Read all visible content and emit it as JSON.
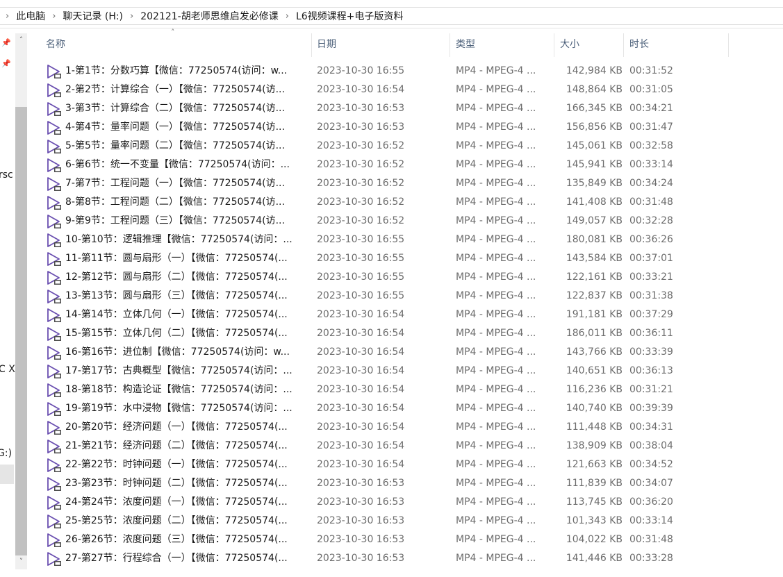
{
  "breadcrumb": {
    "lead": "",
    "items": [
      "此电脑",
      "聊天记录 (H:)",
      "202121-胡老师思维启发必修课",
      "L6视频课程+电子版资料"
    ],
    "separator": "›"
  },
  "nav_fragments": [
    "rsc",
    "C X",
    "G:)"
  ],
  "columns": {
    "name": "名称",
    "date": "日期",
    "type": "类型",
    "size": "大小",
    "duration": "时长"
  },
  "icons": {
    "file": "video-play-icon",
    "pin": "pin-icon"
  },
  "colors": {
    "header_text": "#4c607a",
    "icon_purple": "#6a4fb0",
    "detail_text": "#6d6d6d"
  },
  "files": [
    {
      "name": "1-第1节：分数巧算【微信：77250574(访问：w...",
      "date": "2023-10-30 16:55",
      "type": "MP4 - MPEG-4 ...",
      "size": "142,984 KB",
      "duration": "00:31:52"
    },
    {
      "name": "2-第2节：计算综合（一）【微信：77250574(访...",
      "date": "2023-10-30 16:54",
      "type": "MP4 - MPEG-4 ...",
      "size": "148,864 KB",
      "duration": "00:31:05"
    },
    {
      "name": "3-第3节：计算综合（二）【微信：77250574(访...",
      "date": "2023-10-30 16:53",
      "type": "MP4 - MPEG-4 ...",
      "size": "166,345 KB",
      "duration": "00:34:21"
    },
    {
      "name": "4-第4节：量率问题（一）【微信：77250574(访...",
      "date": "2023-10-30 16:53",
      "type": "MP4 - MPEG-4 ...",
      "size": "156,856 KB",
      "duration": "00:31:47"
    },
    {
      "name": "5-第5节：量率问题（二）【微信：77250574(访...",
      "date": "2023-10-30 16:52",
      "type": "MP4 - MPEG-4 ...",
      "size": "145,061 KB",
      "duration": "00:32:58"
    },
    {
      "name": "6-第6节：统一不变量【微信：77250574(访问：...",
      "date": "2023-10-30 16:52",
      "type": "MP4 - MPEG-4 ...",
      "size": "145,941 KB",
      "duration": "00:33:14"
    },
    {
      "name": "7-第7节：工程问题（一）【微信：77250574(访...",
      "date": "2023-10-30 16:52",
      "type": "MP4 - MPEG-4 ...",
      "size": "135,849 KB",
      "duration": "00:34:24"
    },
    {
      "name": "8-第8节：工程问题（二）【微信：77250574(访...",
      "date": "2023-10-30 16:52",
      "type": "MP4 - MPEG-4 ...",
      "size": "141,408 KB",
      "duration": "00:31:48"
    },
    {
      "name": "9-第9节：工程问题（三）【微信：77250574(访...",
      "date": "2023-10-30 16:52",
      "type": "MP4 - MPEG-4 ...",
      "size": "149,057 KB",
      "duration": "00:32:28"
    },
    {
      "name": "10-第10节：逻辑推理【微信：77250574(访问：...",
      "date": "2023-10-30 16:55",
      "type": "MP4 - MPEG-4 ...",
      "size": "180,081 KB",
      "duration": "00:36:26"
    },
    {
      "name": "11-第11节：圆与扇形（一）【微信：77250574(...",
      "date": "2023-10-30 16:55",
      "type": "MP4 - MPEG-4 ...",
      "size": "143,584 KB",
      "duration": "00:37:01"
    },
    {
      "name": "12-第12节：圆与扇形（二）【微信：77250574(...",
      "date": "2023-10-30 16:55",
      "type": "MP4 - MPEG-4 ...",
      "size": "122,161 KB",
      "duration": "00:33:21"
    },
    {
      "name": "13-第13节：圆与扇形（三）【微信：77250574(...",
      "date": "2023-10-30 16:55",
      "type": "MP4 - MPEG-4 ...",
      "size": "122,837 KB",
      "duration": "00:31:38"
    },
    {
      "name": "14-第14节：立体几何（一）【微信：77250574(...",
      "date": "2023-10-30 16:54",
      "type": "MP4 - MPEG-4 ...",
      "size": "191,181 KB",
      "duration": "00:37:29"
    },
    {
      "name": "15-第15节：立体几何（二）【微信：77250574(...",
      "date": "2023-10-30 16:54",
      "type": "MP4 - MPEG-4 ...",
      "size": "186,011 KB",
      "duration": "00:36:11"
    },
    {
      "name": "16-第16节：进位制【微信：77250574(访问：w...",
      "date": "2023-10-30 16:54",
      "type": "MP4 - MPEG-4 ...",
      "size": "143,766 KB",
      "duration": "00:33:39"
    },
    {
      "name": "17-第17节：古典概型【微信：77250574(访问：...",
      "date": "2023-10-30 16:54",
      "type": "MP4 - MPEG-4 ...",
      "size": "140,651 KB",
      "duration": "00:36:13"
    },
    {
      "name": "18-第18节：构造论证【微信：77250574(访问：...",
      "date": "2023-10-30 16:54",
      "type": "MP4 - MPEG-4 ...",
      "size": "116,236 KB",
      "duration": "00:31:21"
    },
    {
      "name": "19-第19节：水中浸物【微信：77250574(访问：...",
      "date": "2023-10-30 16:54",
      "type": "MP4 - MPEG-4 ...",
      "size": "140,740 KB",
      "duration": "00:39:39"
    },
    {
      "name": "20-第20节：经济问题（一）【微信：77250574(...",
      "date": "2023-10-30 16:54",
      "type": "MP4 - MPEG-4 ...",
      "size": "111,448 KB",
      "duration": "00:34:31"
    },
    {
      "name": "21-第21节：经济问题（二）【微信：77250574(...",
      "date": "2023-10-30 16:54",
      "type": "MP4 - MPEG-4 ...",
      "size": "138,909 KB",
      "duration": "00:38:04"
    },
    {
      "name": "22-第22节：时钟问题（一）【微信：77250574(...",
      "date": "2023-10-30 16:54",
      "type": "MP4 - MPEG-4 ...",
      "size": "121,663 KB",
      "duration": "00:34:52"
    },
    {
      "name": "23-第23节：时钟问题（二）【微信：77250574(...",
      "date": "2023-10-30 16:53",
      "type": "MP4 - MPEG-4 ...",
      "size": "111,839 KB",
      "duration": "00:34:07"
    },
    {
      "name": "24-第24节：浓度问题（一）【微信：77250574(...",
      "date": "2023-10-30 16:53",
      "type": "MP4 - MPEG-4 ...",
      "size": "113,745 KB",
      "duration": "00:36:20"
    },
    {
      "name": "25-第25节：浓度问题（二）【微信：77250574(...",
      "date": "2023-10-30 16:53",
      "type": "MP4 - MPEG-4 ...",
      "size": "101,343 KB",
      "duration": "00:33:14"
    },
    {
      "name": "26-第26节：浓度问题（三）【微信：77250574(...",
      "date": "2023-10-30 16:53",
      "type": "MP4 - MPEG-4 ...",
      "size": "104,022 KB",
      "duration": "00:31:48"
    },
    {
      "name": "27-第27节：行程综合（一）【微信：77250574(...",
      "date": "2023-10-30 16:53",
      "type": "MP4 - MPEG-4 ...",
      "size": "141,446 KB",
      "duration": "00:33:28"
    }
  ]
}
